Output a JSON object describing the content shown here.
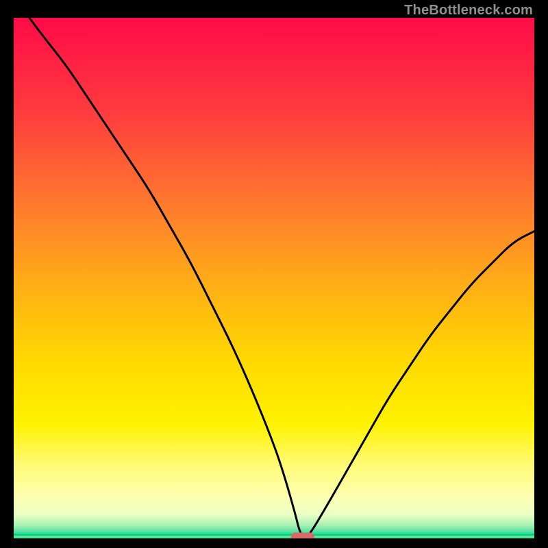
{
  "watermark": "TheBottleneck.com",
  "chart_data": {
    "type": "line",
    "title": "",
    "xlabel": "",
    "ylabel": "",
    "xlim": [
      0,
      100
    ],
    "ylim": [
      0,
      100
    ],
    "grid": false,
    "series": [
      {
        "name": "bottleneck-curve",
        "x": [
          3,
          6,
          10,
          14,
          18,
          22,
          26,
          30,
          34,
          38,
          42,
          46,
          50,
          52,
          54,
          55,
          56,
          57,
          60,
          64,
          68,
          72,
          76,
          80,
          84,
          88,
          92,
          96,
          100
        ],
        "y": [
          100,
          96,
          91,
          85,
          79,
          73,
          67,
          60,
          53,
          45,
          37,
          28,
          18,
          12,
          5,
          1,
          0,
          1,
          6,
          13,
          20,
          27,
          33,
          39,
          44,
          49,
          53,
          57,
          59
        ]
      }
    ],
    "marker": {
      "x": 55.5,
      "y": 0,
      "color": "#d96a6a",
      "shape": "pill"
    },
    "baseline": {
      "y": 0,
      "colors": [
        "#00d184",
        "#6fe29a"
      ]
    },
    "background_gradient": {
      "stops": [
        {
          "pos": 0.0,
          "color": "#ff0b48"
        },
        {
          "pos": 0.18,
          "color": "#ff3b3e"
        },
        {
          "pos": 0.36,
          "color": "#ff7a2d"
        },
        {
          "pos": 0.52,
          "color": "#ffb015"
        },
        {
          "pos": 0.66,
          "color": "#ffd900"
        },
        {
          "pos": 0.78,
          "color": "#fff200"
        },
        {
          "pos": 0.86,
          "color": "#fffb77"
        },
        {
          "pos": 0.92,
          "color": "#fdffb0"
        },
        {
          "pos": 0.955,
          "color": "#e9ffc4"
        },
        {
          "pos": 0.975,
          "color": "#a7f0b2"
        },
        {
          "pos": 0.99,
          "color": "#3fe09b"
        },
        {
          "pos": 1.0,
          "color": "#00d184"
        }
      ]
    }
  }
}
